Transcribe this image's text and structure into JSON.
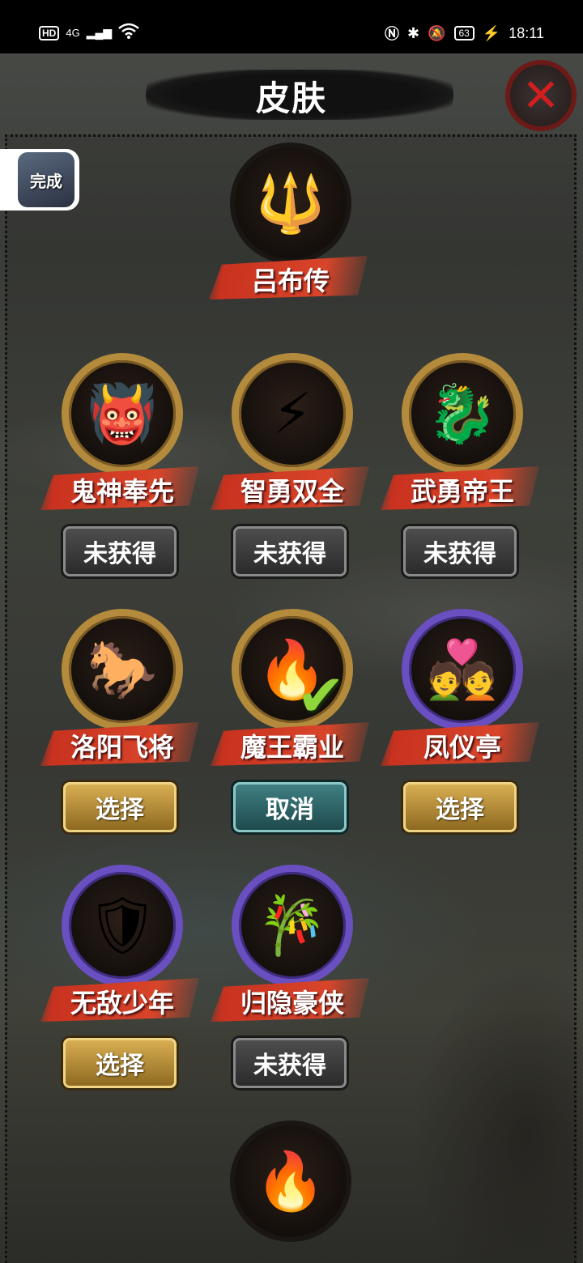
{
  "status_bar": {
    "left": [
      "HD",
      "4G",
      "▂▄▆",
      "WiFi"
    ],
    "right": {
      "icons": [
        "NFC",
        "Bluetooth",
        "Mute"
      ],
      "battery": "63",
      "time": "18:11"
    }
  },
  "header": {
    "title": "皮肤"
  },
  "done_button": {
    "label": "完成"
  },
  "featured": {
    "name": "吕布传",
    "emoji": "🔱"
  },
  "skins": [
    {
      "name": "鬼神奉先",
      "frame": "gold",
      "emoji": "👹",
      "action": "未获得",
      "state": "locked"
    },
    {
      "name": "智勇双全",
      "frame": "gold",
      "emoji": "⚡",
      "action": "未获得",
      "state": "locked"
    },
    {
      "name": "武勇帝王",
      "frame": "gold",
      "emoji": "🐉",
      "action": "未获得",
      "state": "locked"
    },
    {
      "name": "洛阳飞将",
      "frame": "gold",
      "emoji": "🐎",
      "action": "选择",
      "state": "select"
    },
    {
      "name": "魔王霸业",
      "frame": "gold",
      "emoji": "🔥",
      "action": "取消",
      "state": "selected"
    },
    {
      "name": "凤仪亭",
      "frame": "purple",
      "emoji": "💑",
      "action": "选择",
      "state": "select"
    },
    {
      "name": "无敌少年",
      "frame": "purple",
      "emoji": "🛡",
      "action": "选择",
      "state": "select"
    },
    {
      "name": "归隐豪侠",
      "frame": "purple",
      "emoji": "🎋",
      "action": "未获得",
      "state": "locked"
    }
  ],
  "bottom_preview": {
    "emoji": "🔥"
  },
  "colors": {
    "gold_frame": "#b48a3c",
    "purple_frame": "#6a4fc0",
    "name_banner": "#d8452a",
    "select_button": "#d8ae52",
    "cancel_button": "#3f7f82",
    "locked_button": "#4d4d4d",
    "check": "#8ed63a"
  }
}
